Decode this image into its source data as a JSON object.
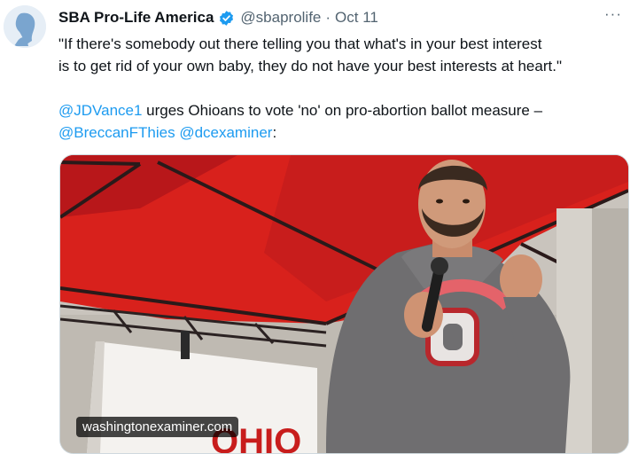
{
  "author": {
    "name": "SBA Pro-Life America",
    "handle": "@sbaprolife",
    "separator": "·",
    "date": "Oct 11"
  },
  "more_label": "···",
  "tweet": {
    "quote_line1": "\"If there's somebody out there telling you that what's in your best interest",
    "quote_line2": "is to get rid of your own baby, they do not have your best interests at heart.\"",
    "mention1": "@JDVance1",
    "line3_rest": " urges Ohioans to vote 'no' on pro-abortion ballot measure –",
    "mention2": "@BreccanFThies",
    "space": " ",
    "mention3": "@dcexaminer",
    "colon": ":"
  },
  "media": {
    "watermark": "washingtonexaminer.com",
    "podium_text": "OHIO"
  },
  "colors": {
    "link": "#1d9bf0",
    "verified": "#1d9bf0",
    "secondary_text": "#536471",
    "canopy_red": "#d8211c"
  }
}
